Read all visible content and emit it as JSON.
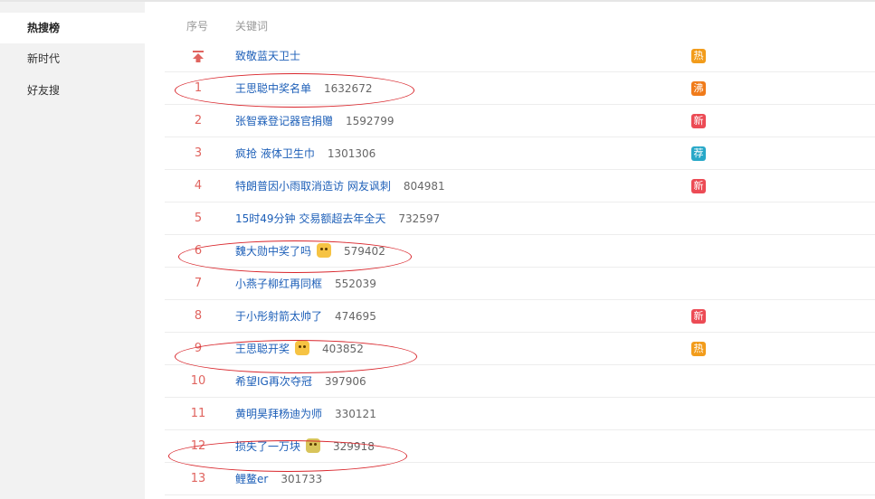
{
  "sidebar": {
    "items": [
      {
        "label": "热搜榜",
        "active": true
      },
      {
        "label": "新时代",
        "active": false
      },
      {
        "label": "好友搜",
        "active": false
      }
    ]
  },
  "table": {
    "header": {
      "rank": "序号",
      "keyword": "关键词"
    },
    "rows": [
      {
        "rank": "",
        "pinned": true,
        "keyword": "致敬蓝天卫士",
        "count": "",
        "emoji": "",
        "badge": "热",
        "badge_color": "#f29c1b"
      },
      {
        "rank": "1",
        "keyword": "王思聪中奖名单",
        "count": "1632672",
        "emoji": "",
        "badge": "沸",
        "badge_color": "#f07b1a"
      },
      {
        "rank": "2",
        "keyword": "张智霖登记器官捐赠",
        "count": "1592799",
        "emoji": "",
        "badge": "新",
        "badge_color": "#ec4b55"
      },
      {
        "rank": "3",
        "keyword": "疯抢 液体卫生巾",
        "count": "1301306",
        "emoji": "",
        "badge": "荐",
        "badge_color": "#28a8c8"
      },
      {
        "rank": "4",
        "keyword": "特朗普因小雨取消造访 网友讽刺",
        "count": "804981",
        "emoji": "",
        "badge": "新",
        "badge_color": "#ec4b55"
      },
      {
        "rank": "5",
        "keyword": "15时49分钟 交易额超去年全天",
        "count": "732597",
        "emoji": "",
        "badge": "",
        "badge_color": ""
      },
      {
        "rank": "6",
        "keyword": "魏大勋中奖了吗",
        "count": "579402",
        "emoji": "doge-emoji",
        "badge": "",
        "badge_color": ""
      },
      {
        "rank": "7",
        "keyword": "小燕子柳红再同框",
        "count": "552039",
        "emoji": "",
        "badge": "",
        "badge_color": ""
      },
      {
        "rank": "8",
        "keyword": "于小彤射箭太帅了",
        "count": "474695",
        "emoji": "",
        "badge": "新",
        "badge_color": "#ec4b55"
      },
      {
        "rank": "9",
        "keyword": "王思聪开奖",
        "count": "403852",
        "emoji": "doge-emoji",
        "badge": "热",
        "badge_color": "#f29c1b"
      },
      {
        "rank": "10",
        "keyword": "希望IG再次夺冠",
        "count": "397906",
        "emoji": "",
        "badge": "",
        "badge_color": ""
      },
      {
        "rank": "11",
        "keyword": "黄明昊拜杨迪为师",
        "count": "330121",
        "emoji": "",
        "badge": "",
        "badge_color": ""
      },
      {
        "rank": "12",
        "keyword": "损失了一万块",
        "count": "329918",
        "emoji": "crying-emoji",
        "badge": "",
        "badge_color": ""
      },
      {
        "rank": "13",
        "keyword": "鲤鳌er",
        "count": "301733",
        "emoji": "",
        "badge": "",
        "badge_color": ""
      }
    ]
  },
  "colors": {
    "rank_top": "#e0645f",
    "keyword_link": "#1d5fb8",
    "annotation_red": "#d9262c"
  }
}
